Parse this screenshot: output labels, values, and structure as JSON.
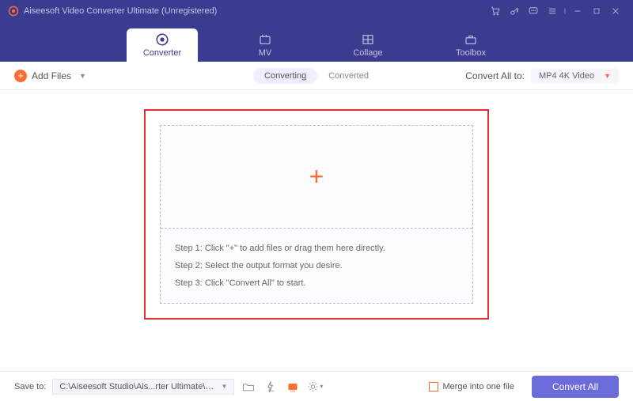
{
  "title": "Aiseesoft Video Converter Ultimate (Unregistered)",
  "tabs": {
    "converter": "Converter",
    "mv": "MV",
    "collage": "Collage",
    "toolbox": "Toolbox"
  },
  "toolbar": {
    "add_files": "Add Files",
    "converting": "Converting",
    "converted": "Converted",
    "convert_all_to": "Convert All to:",
    "format": "MP4 4K Video"
  },
  "drop": {
    "step1": "Step 1: Click \"+\" to add files or drag them here directly.",
    "step2": "Step 2: Select the output format you desire.",
    "step3": "Step 3: Click \"Convert All\" to start."
  },
  "footer": {
    "save_to": "Save to:",
    "path": "C:\\Aiseesoft Studio\\Ais...rter Ultimate\\Converted",
    "merge": "Merge into one file",
    "convert_all": "Convert All"
  }
}
